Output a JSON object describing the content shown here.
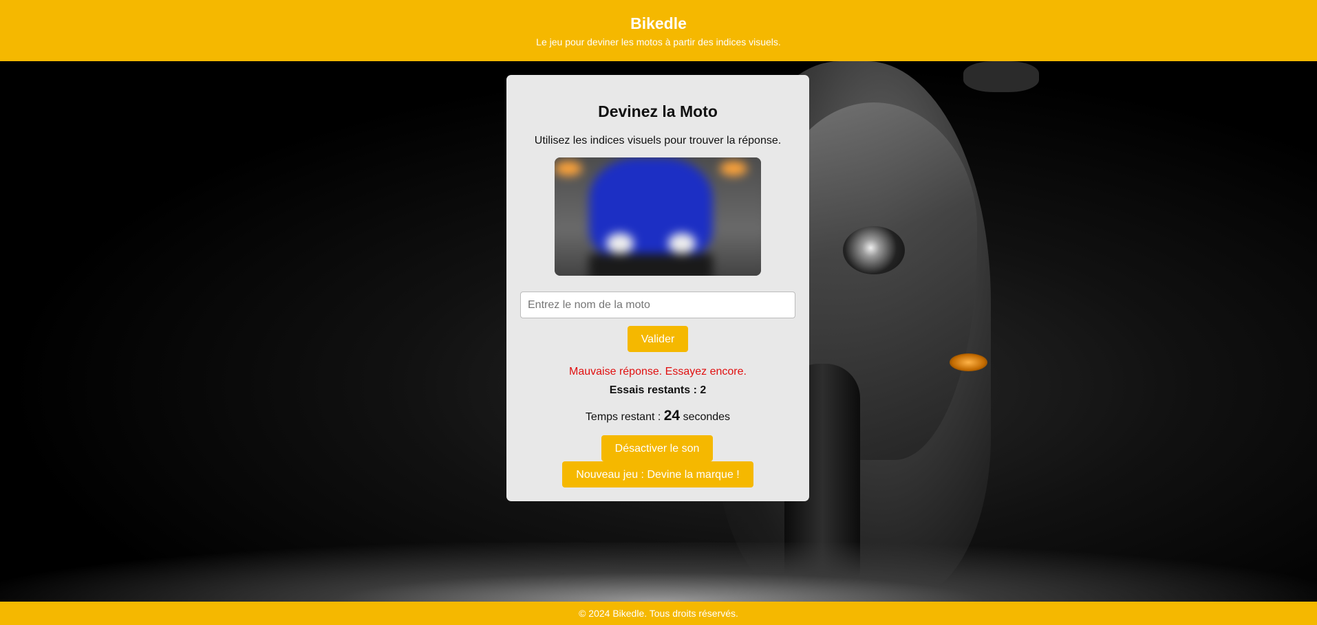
{
  "header": {
    "title": "Bikedle",
    "subtitle": "Le jeu pour deviner les motos à partir des indices visuels."
  },
  "game": {
    "title": "Devinez la Moto",
    "intro": "Utilisez les indices visuels pour trouver la réponse.",
    "input_placeholder": "Entrez le nom de la moto",
    "input_value": "",
    "validate_label": "Valider",
    "feedback": "Mauvaise réponse. Essayez encore.",
    "tries_label": "Essais restants : 2",
    "timer_prefix": "Temps restant :",
    "timer_value": "24",
    "timer_suffix": "secondes",
    "sound_label": "Désactiver le son",
    "new_game_label": "Nouveau jeu : Devine la marque !"
  },
  "footer": {
    "text": "© 2024 Bikedle. Tous droits réservés."
  },
  "colors": {
    "accent": "#f5b800",
    "error": "#e01010",
    "card": "#e8e8e8"
  }
}
